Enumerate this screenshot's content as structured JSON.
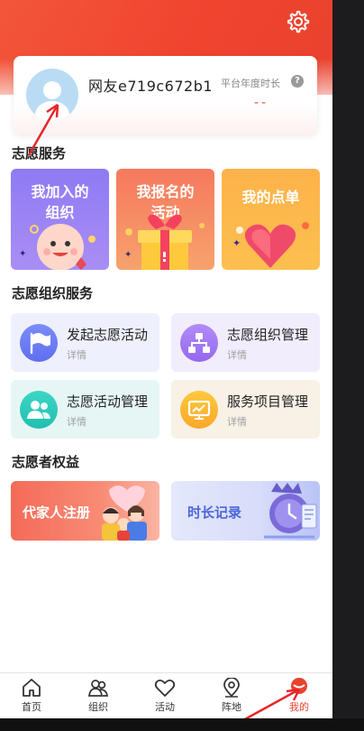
{
  "profile": {
    "username": "网友e719c672b1",
    "year_label": "平台年度时长",
    "help_glyph": "?",
    "year_value": "--"
  },
  "sections": {
    "volunteer_service": "志愿服务",
    "org_service": "志愿组织服务",
    "rights": "志愿者权益"
  },
  "big_cards": [
    {
      "label": "我加入的组织",
      "line1": "我加入的",
      "line2": "组织"
    },
    {
      "label": "我报名的活动",
      "line1": "我报名的",
      "line2": "活动"
    },
    {
      "label": "我的点单",
      "line1": "我的点单",
      "line2": ""
    }
  ],
  "service_cards": [
    {
      "title": "发起志愿活动",
      "detail": "详情",
      "icon": "flag-icon"
    },
    {
      "title": "志愿组织管理",
      "detail": "详情",
      "icon": "org-chart-icon"
    },
    {
      "title": "志愿活动管理",
      "detail": "详情",
      "icon": "people-icon"
    },
    {
      "title": "服务项目管理",
      "detail": "详情",
      "icon": "chart-board-icon"
    }
  ],
  "rights_cards": [
    {
      "title": "代家人注册"
    },
    {
      "title": "时长记录"
    }
  ],
  "tabbar": [
    {
      "label": "首页",
      "icon": "home-icon"
    },
    {
      "label": "组织",
      "icon": "group-icon"
    },
    {
      "label": "活动",
      "icon": "heart-icon"
    },
    {
      "label": "阵地",
      "icon": "location-icon"
    },
    {
      "label": "我的",
      "icon": "profile-icon",
      "active": true
    }
  ],
  "colors": {
    "brand": "#f0442f",
    "card_purple": "#8f7af5",
    "card_orange": "#f6795e",
    "card_yellow": "#fdb24a"
  }
}
